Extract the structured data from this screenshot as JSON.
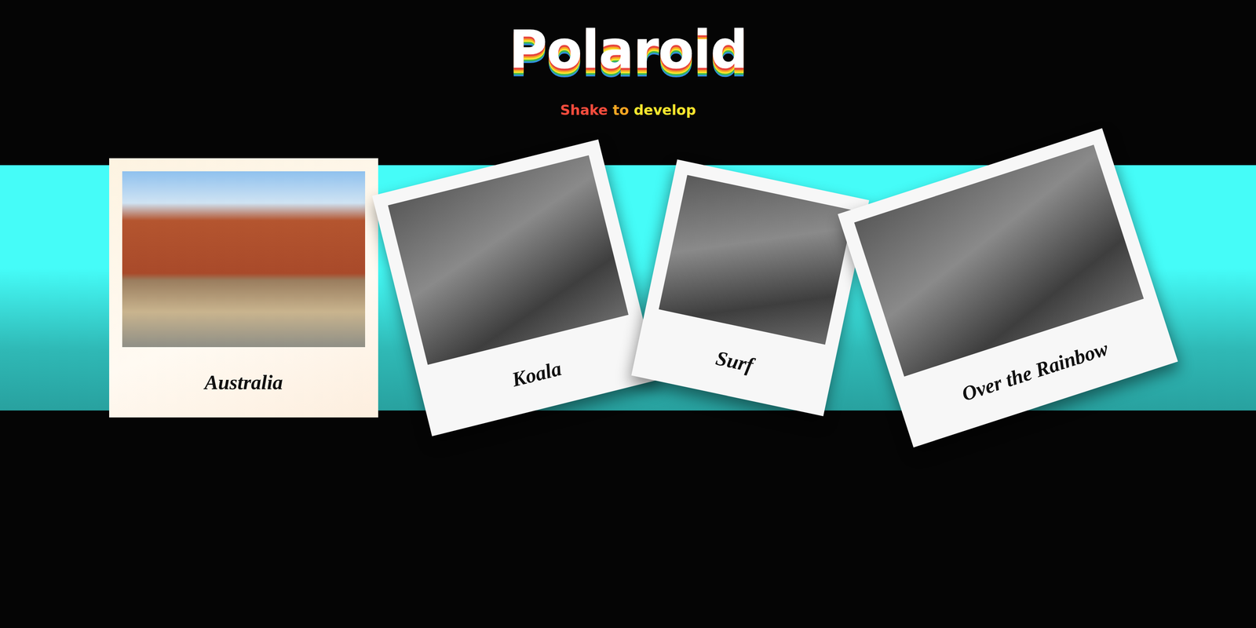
{
  "header": {
    "title": "Polaroid",
    "subtitle": [
      {
        "text": "Shake",
        "color": "#f24c3d"
      },
      {
        "text": "to",
        "color": "#f5a623"
      },
      {
        "text": "develop",
        "color": "#f7e52e"
      }
    ]
  },
  "photos": [
    {
      "caption": "Australia",
      "developed": true
    },
    {
      "caption": "Koala",
      "developed": false
    },
    {
      "caption": "Surf",
      "developed": false
    },
    {
      "caption": "Over the Rainbow",
      "developed": false
    }
  ]
}
